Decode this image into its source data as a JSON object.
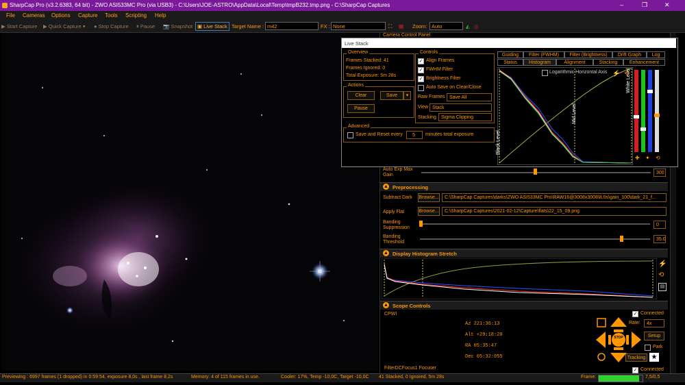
{
  "window": {
    "title": "SharpCap Pro (v3.2.6383, 64 bit) - ZWO ASI533MC Pro (via USB3) - C:\\Users\\JOE-ASTRO\\AppData\\Local\\Temp\\tmpB232.tmp.png - C:\\SharpCap Captures",
    "minimize": "–",
    "maximize": "❐",
    "close": "✕"
  },
  "menu": [
    "File",
    "Cameras",
    "Options",
    "Capture",
    "Tools",
    "Scripting",
    "Help"
  ],
  "toolbar": {
    "start_capture": "Start Capture",
    "quick_capture": "Quick Capture",
    "stop_capture": "Stop Capture",
    "pause": "Pause",
    "snapshot": "Snapshot",
    "live_stack": "Live Stack",
    "target_label": "Target Name :",
    "target_value": "m42",
    "fx_label": "FX :",
    "fx_value": "None",
    "zoom_label": "Zoom:",
    "zoom_value": "Auto"
  },
  "live_stack": {
    "title": "Live Stack",
    "overview": {
      "title": "Overview",
      "stacked": "Frames Stacked: 41",
      "ignored": "Frames Ignored:  0",
      "exposure": "Total Exposure:   5m 28s"
    },
    "actions": {
      "title": "Actions",
      "clear": "Clear",
      "save": "Save",
      "pause": "Pause"
    },
    "advanced": {
      "title": "Advanced",
      "save_reset": "Save and Reset every",
      "minutes_value": "5",
      "minutes_label": "minutes total exposure"
    },
    "controls": {
      "title": "Controls",
      "align": "Align Frames",
      "fwhm": "FWHM Filter",
      "brightness": "Brightness Filter",
      "autosave": "Auto Save on Clear/Close",
      "raw_label": "Raw Frames",
      "raw_value": "Save All",
      "view_label": "View",
      "view_value": "Stack",
      "stacking_label": "Stacking",
      "stacking_value": "Sigma Clipping"
    },
    "tabs_row1": [
      "Guiding",
      "Filter (FWHM)",
      "Filter (Brightness)",
      "Drift Graph",
      "Log"
    ],
    "tabs_row2": [
      "Status",
      "Histogram",
      "Alignment",
      "Stacking",
      "Enhancement"
    ],
    "histogram": {
      "log_axis": "Logarithmic Horizontal Axis",
      "black_level": "Black Level",
      "mid_level": "Mid Level",
      "white_level": "White Level"
    }
  },
  "camera_panel": {
    "title": "Camera Control Panel",
    "auto_exp_label": "Auto Exp Max Gain",
    "auto_exp_value": "300"
  },
  "preprocessing": {
    "title": "Preprocessing",
    "dark_label": "Subtract Dark",
    "dark_browse": "Browse...",
    "dark_path": "C:\\SharpCap Captures\\darks\\ZWO ASI533MC Pro\\RAW16@3008x3008\\8.0s\\gain_100\\dark_21_f...",
    "flat_label": "Apply Flat",
    "flat_browse": "Browse...",
    "flat_path": "C:\\SharpCap Captures\\2021-02-12\\Capture\\flats\\22_15_09.png",
    "banding_supp_label": "Banding Suppression",
    "banding_supp_value": "0",
    "banding_thr_label": "Banding Threshold",
    "banding_thr_value": "35.0"
  },
  "display_stretch": {
    "title": "Display Histogram Stretch"
  },
  "scope": {
    "title": "Scope Controls",
    "driver": "CPWI",
    "connected": "Connected",
    "az": "Az    221:36:13",
    "alt": "Alt  +29:18:20",
    "ra": "RA    05:35:47",
    "dec": "Dec  05:32:055",
    "rate_label": "Rate:",
    "rate_value": "4x",
    "setup": "Setup",
    "park": "Park",
    "stop": "STOP",
    "tracking": "Tracking"
  },
  "focuser": {
    "title": "FilterDCFocus1 Focuser",
    "connected": "Connected"
  },
  "status": {
    "preview": "Previewing : 6997 frames (1 dropped) in 0:59:54, exposure 8,0s , last frame 8,2s",
    "memory": "Memory: 4 of 115 frames in use.",
    "cooler": "Cooler: 17%, Temp -10,0C, Target -10,0C",
    "stack": "41 Stacked, 0 Ignored, 5m 28s",
    "frame_label": "Frame:",
    "frame_value": "7,5/0,5",
    "frame_progress": 0.92
  },
  "colors": {
    "accent": "#ff9800",
    "title_bar": "#7a1a9a",
    "panel_bg": "#000000"
  }
}
